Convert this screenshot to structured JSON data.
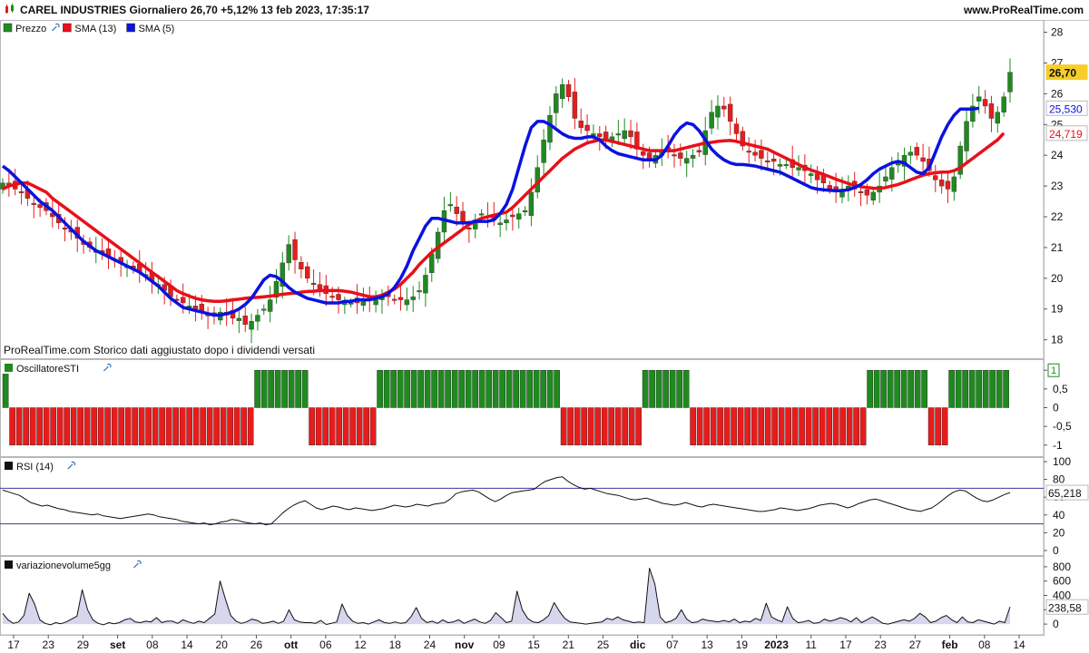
{
  "header": {
    "title": "CAREL INDUSTRIES Giornaliero 26,70 +5,12% 13 feb 2023, 17:35:17",
    "site": "www.ProRealTime.com"
  },
  "footnote": "ProRealTime.com  Storico dati aggiustato dopo i dividendi versati",
  "colors": {
    "up": "#1f8a1f",
    "down": "#e81c1c",
    "sma13": "#e8101a",
    "sma5": "#0a12e0",
    "line": "#111111",
    "band": "#3a3aa0",
    "vol_fill": "#d6d6ec"
  },
  "chart_data": [
    {
      "type": "candlestick",
      "legend": [
        "Prezzo",
        "SMA (13)",
        "SMA (5)"
      ],
      "ylim": [
        17.4,
        28.4
      ],
      "yticks": [
        "18",
        "19",
        "20",
        "21",
        "22",
        "23",
        "24",
        "25",
        "26",
        "27",
        "28"
      ],
      "last_price": "26,70",
      "sma5_label": "25,530",
      "sma13_label": "24,719",
      "x_labels": [
        "17",
        "23",
        "29",
        "set",
        "08",
        "14",
        "20",
        "26",
        "ott",
        "06",
        "12",
        "18",
        "24",
        "nov",
        "09",
        "15",
        "21",
        "25",
        "dic",
        "07",
        "13",
        "19",
        "2023",
        "11",
        "17",
        "23",
        "27",
        "feb",
        "08",
        "14"
      ],
      "closes": [
        23.1,
        23.0,
        22.9,
        22.8,
        22.6,
        22.4,
        22.3,
        22.2,
        22.0,
        21.8,
        21.6,
        21.5,
        21.3,
        21.1,
        21.0,
        20.9,
        20.8,
        20.7,
        20.6,
        20.5,
        20.4,
        20.3,
        20.2,
        20.1,
        19.9,
        19.8,
        19.6,
        19.4,
        19.3,
        19.2,
        19.1,
        19.0,
        18.9,
        18.8,
        18.8,
        18.9,
        18.8,
        18.7,
        18.7,
        18.5,
        18.6,
        18.8,
        19.0,
        19.3,
        19.9,
        20.5,
        21.1,
        20.6,
        20.3,
        20.0,
        19.8,
        19.6,
        19.5,
        19.4,
        19.3,
        19.2,
        19.2,
        19.2,
        19.3,
        19.3,
        19.3,
        19.4,
        19.4,
        19.3,
        19.3,
        19.3,
        19.4,
        19.6,
        20.1,
        20.8,
        21.5,
        22.2,
        22.4,
        22.1,
        21.8,
        21.6,
        21.9,
        22.1,
        22.0,
        21.9,
        21.8,
        21.9,
        22.0,
        22.1,
        22.2,
        22.8,
        23.6,
        24.5,
        25.3,
        26.0,
        26.3,
        25.9,
        25.2,
        24.9,
        24.8,
        24.7,
        24.6,
        24.5,
        24.6,
        24.7,
        24.8,
        24.6,
        24.2,
        24.0,
        23.9,
        24.0,
        24.1,
        24.1,
        24.0,
        23.9,
        23.9,
        24.0,
        24.1,
        24.8,
        25.4,
        25.6,
        25.5,
        25.1,
        24.7,
        24.3,
        24.1,
        24.0,
        23.9,
        23.8,
        23.8,
        23.7,
        23.7,
        23.6,
        23.6,
        23.5,
        23.4,
        23.2,
        23.1,
        22.9,
        22.8,
        22.9,
        23.0,
        22.9,
        22.8,
        22.7,
        22.8,
        23.0,
        23.3,
        23.6,
        23.8,
        24.0,
        24.1,
        24.0,
        23.8,
        23.5,
        23.2,
        23.0,
        22.9,
        23.3,
        24.3,
        25.1,
        25.6,
        25.9,
        25.6,
        25.2,
        25.4,
        25.9,
        26.7
      ],
      "sma13": [
        22.9,
        23.0,
        23.05,
        23.1,
        23.1,
        23.0,
        22.9,
        22.8,
        22.6,
        22.45,
        22.3,
        22.15,
        22.0,
        21.85,
        21.7,
        21.55,
        21.4,
        21.25,
        21.1,
        20.95,
        20.8,
        20.65,
        20.5,
        20.35,
        20.2,
        20.05,
        19.9,
        19.75,
        19.6,
        19.5,
        19.42,
        19.35,
        19.3,
        19.27,
        19.25,
        19.25,
        19.27,
        19.3,
        19.32,
        19.35,
        19.37,
        19.38,
        19.4,
        19.42,
        19.45,
        19.48,
        19.5,
        19.52,
        19.55,
        19.57,
        19.58,
        19.6,
        19.6,
        19.6,
        19.6,
        19.58,
        19.55,
        19.5,
        19.45,
        19.4,
        19.4,
        19.45,
        19.55,
        19.65,
        19.8,
        20.0,
        20.2,
        20.45,
        20.65,
        20.85,
        21.0,
        21.15,
        21.3,
        21.45,
        21.6,
        21.75,
        21.85,
        21.95,
        22.0,
        22.05,
        22.1,
        22.15,
        22.3,
        22.5,
        22.7,
        22.9,
        23.1,
        23.3,
        23.5,
        23.7,
        23.9,
        24.05,
        24.2,
        24.3,
        24.4,
        24.45,
        24.5,
        24.5,
        24.45,
        24.4,
        24.35,
        24.3,
        24.25,
        24.2,
        24.15,
        24.15,
        24.15,
        24.15,
        24.15,
        24.2,
        24.25,
        24.3,
        24.35,
        24.4,
        24.42,
        24.45,
        24.47,
        24.48,
        24.45,
        24.4,
        24.35,
        24.3,
        24.25,
        24.2,
        24.1,
        24.0,
        23.9,
        23.8,
        23.7,
        23.6,
        23.52,
        23.45,
        23.38,
        23.3,
        23.22,
        23.15,
        23.08,
        23.02,
        22.98,
        22.95,
        22.93,
        22.92,
        22.95,
        23.0,
        23.05,
        23.12,
        23.2,
        23.28,
        23.35,
        23.4,
        23.43,
        23.45,
        23.45,
        23.5,
        23.6,
        23.75,
        23.9,
        24.05,
        24.2,
        24.35,
        24.5,
        24.72
      ],
      "sma5": [
        23.65,
        23.5,
        23.3,
        23.1,
        22.9,
        22.7,
        22.5,
        22.35,
        22.2,
        22.0,
        21.8,
        21.6,
        21.4,
        21.2,
        21.05,
        20.9,
        20.8,
        20.7,
        20.6,
        20.5,
        20.4,
        20.3,
        20.2,
        20.05,
        19.9,
        19.75,
        19.55,
        19.35,
        19.2,
        19.05,
        19.0,
        18.95,
        18.9,
        18.85,
        18.8,
        18.8,
        18.85,
        18.9,
        19.0,
        19.15,
        19.35,
        19.65,
        19.95,
        20.1,
        20.05,
        19.9,
        19.7,
        19.55,
        19.45,
        19.35,
        19.3,
        19.25,
        19.2,
        19.2,
        19.2,
        19.25,
        19.25,
        19.3,
        19.3,
        19.3,
        19.35,
        19.4,
        19.5,
        19.7,
        20.0,
        20.4,
        20.9,
        21.3,
        21.7,
        21.95,
        21.95,
        21.9,
        21.85,
        21.8,
        21.8,
        21.8,
        21.85,
        21.85,
        21.85,
        21.9,
        22.1,
        22.4,
        22.9,
        23.6,
        24.3,
        24.9,
        25.1,
        25.1,
        25.0,
        24.85,
        24.7,
        24.6,
        24.55,
        24.55,
        24.6,
        24.6,
        24.5,
        24.3,
        24.15,
        24.05,
        24.0,
        23.95,
        23.9,
        23.85,
        23.85,
        23.85,
        24.0,
        24.3,
        24.65,
        24.9,
        25.05,
        25.0,
        24.8,
        24.5,
        24.2,
        24.0,
        23.85,
        23.75,
        23.7,
        23.7,
        23.68,
        23.65,
        23.6,
        23.55,
        23.5,
        23.45,
        23.35,
        23.25,
        23.15,
        23.05,
        22.95,
        22.9,
        22.88,
        22.86,
        22.85,
        22.85,
        22.88,
        22.95,
        23.05,
        23.2,
        23.4,
        23.55,
        23.65,
        23.75,
        23.8,
        23.75,
        23.6,
        23.45,
        23.4,
        23.6,
        24.1,
        24.6,
        25.0,
        25.3,
        25.5,
        25.5,
        25.5,
        25.53
      ]
    },
    {
      "type": "bar",
      "legend": [
        "OscillatoreSTI"
      ],
      "ylim": [
        -1.15,
        1.15
      ],
      "yticks": [
        "1",
        "0,5",
        "0",
        "-0,5",
        "-1"
      ],
      "last_value_label": "1",
      "signals": [
        1,
        -1,
        -1,
        -1,
        -1,
        -1,
        -1,
        -1,
        -1,
        -1,
        -1,
        -1,
        -1,
        -1,
        -1,
        -1,
        -1,
        -1,
        -1,
        -1,
        -1,
        -1,
        -1,
        -1,
        -1,
        -1,
        -1,
        -1,
        -1,
        -1,
        -1,
        -1,
        -1,
        -1,
        -1,
        -1,
        -1,
        1,
        1,
        1,
        1,
        1,
        1,
        1,
        1,
        -1,
        -1,
        -1,
        -1,
        -1,
        -1,
        -1,
        -1,
        -1,
        -1,
        1,
        1,
        1,
        1,
        1,
        1,
        1,
        1,
        1,
        1,
        1,
        1,
        1,
        1,
        1,
        1,
        1,
        1,
        1,
        1,
        1,
        1,
        1,
        1,
        1,
        1,
        1,
        -1,
        -1,
        -1,
        -1,
        -1,
        -1,
        -1,
        -1,
        -1,
        -1,
        -1,
        -1,
        1,
        1,
        1,
        1,
        1,
        1,
        1,
        -1,
        -1,
        -1,
        -1,
        -1,
        -1,
        -1,
        -1,
        -1,
        -1,
        -1,
        -1,
        -1,
        -1,
        -1,
        -1,
        -1,
        -1,
        -1,
        -1,
        -1,
        -1,
        -1,
        -1,
        -1,
        -1,
        1,
        1,
        1,
        1,
        1,
        1,
        1,
        1,
        1,
        -1,
        -1,
        -1,
        1,
        1,
        1,
        1,
        1,
        1,
        1,
        1,
        1
      ]
    },
    {
      "type": "line",
      "legend": [
        "RSI (14)"
      ],
      "ylim": [
        0,
        100
      ],
      "yticks": [
        "0",
        "20",
        "40",
        "60",
        "80",
        "100"
      ],
      "bands": [
        70,
        30
      ],
      "last_value_label": "65,218",
      "values": [
        68,
        66,
        64,
        62,
        58,
        54,
        52,
        50,
        51,
        49,
        47,
        46,
        44,
        43,
        42,
        41,
        40,
        41,
        39,
        38,
        37,
        36,
        37,
        38,
        39,
        40,
        41,
        40,
        38,
        37,
        36,
        35,
        33,
        32,
        31,
        30,
        31,
        29,
        30,
        32,
        33,
        35,
        34,
        32,
        31,
        30,
        31,
        29,
        30,
        36,
        42,
        47,
        51,
        54,
        56,
        52,
        48,
        46,
        48,
        50,
        49,
        47,
        46,
        48,
        47,
        46,
        45,
        46,
        47,
        49,
        51,
        50,
        49,
        50,
        52,
        51,
        50,
        52,
        53,
        54,
        58,
        64,
        66,
        67,
        68,
        66,
        62,
        58,
        55,
        58,
        62,
        65,
        66,
        67,
        68,
        69,
        74,
        78,
        80,
        82,
        83,
        78,
        74,
        71,
        69,
        70,
        68,
        66,
        64,
        63,
        62,
        60,
        58,
        57,
        58,
        59,
        57,
        55,
        53,
        52,
        51,
        52,
        54,
        52,
        50,
        49,
        51,
        52,
        51,
        50,
        49,
        48,
        47,
        46,
        45,
        44,
        44,
        45,
        46,
        48,
        47,
        46,
        45,
        46,
        47,
        49,
        51,
        52,
        53,
        52,
        50,
        48,
        50,
        53,
        55,
        57,
        58,
        56,
        54,
        52,
        50,
        48,
        46,
        45,
        44,
        46,
        48,
        52,
        57,
        62,
        66,
        68,
        67,
        63,
        59,
        56,
        55,
        57,
        60,
        63,
        65.2
      ]
    },
    {
      "type": "area",
      "legend": [
        "variazionevolume5gg"
      ],
      "ylim": [
        -100,
        900
      ],
      "yticks": [
        "0",
        "200",
        "400",
        "600",
        "800"
      ],
      "last_value_label": "238,58",
      "values": [
        150,
        60,
        10,
        30,
        120,
        430,
        280,
        60,
        10,
        -10,
        20,
        5,
        30,
        70,
        110,
        480,
        200,
        60,
        10,
        -10,
        20,
        5,
        20,
        60,
        80,
        30,
        20,
        40,
        30,
        90,
        20,
        40,
        40,
        10,
        60,
        30,
        10,
        40,
        20,
        80,
        140,
        600,
        350,
        120,
        40,
        10,
        30,
        70,
        50,
        10,
        20,
        40,
        10,
        40,
        200,
        60,
        30,
        20,
        20,
        10,
        50,
        -5,
        10,
        30,
        280,
        120,
        40,
        10,
        20,
        0,
        30,
        60,
        20,
        10,
        30,
        10,
        20,
        100,
        230,
        80,
        20,
        40,
        10,
        60,
        20,
        30,
        60,
        10,
        40,
        70,
        30,
        10,
        50,
        160,
        90,
        20,
        40,
        460,
        200,
        80,
        30,
        20,
        60,
        120,
        300,
        180,
        80,
        30,
        20,
        10,
        0,
        10,
        20,
        30,
        80,
        60,
        100,
        60,
        40,
        20,
        30,
        20,
        780,
        560,
        100,
        20,
        40,
        80,
        200,
        70,
        20,
        30,
        70,
        50,
        40,
        30,
        50,
        30,
        70,
        20,
        40,
        30,
        80,
        50,
        290,
        100,
        60,
        30,
        240,
        80,
        20,
        30,
        50,
        10,
        20,
        70,
        40,
        60,
        90,
        70,
        30,
        90,
        20,
        60,
        100,
        60,
        10,
        0,
        20,
        40,
        60,
        40,
        80,
        150,
        100,
        20,
        40,
        90,
        120,
        60,
        20,
        100,
        30,
        20,
        60,
        40,
        20,
        0,
        40,
        20,
        240
      ]
    }
  ]
}
